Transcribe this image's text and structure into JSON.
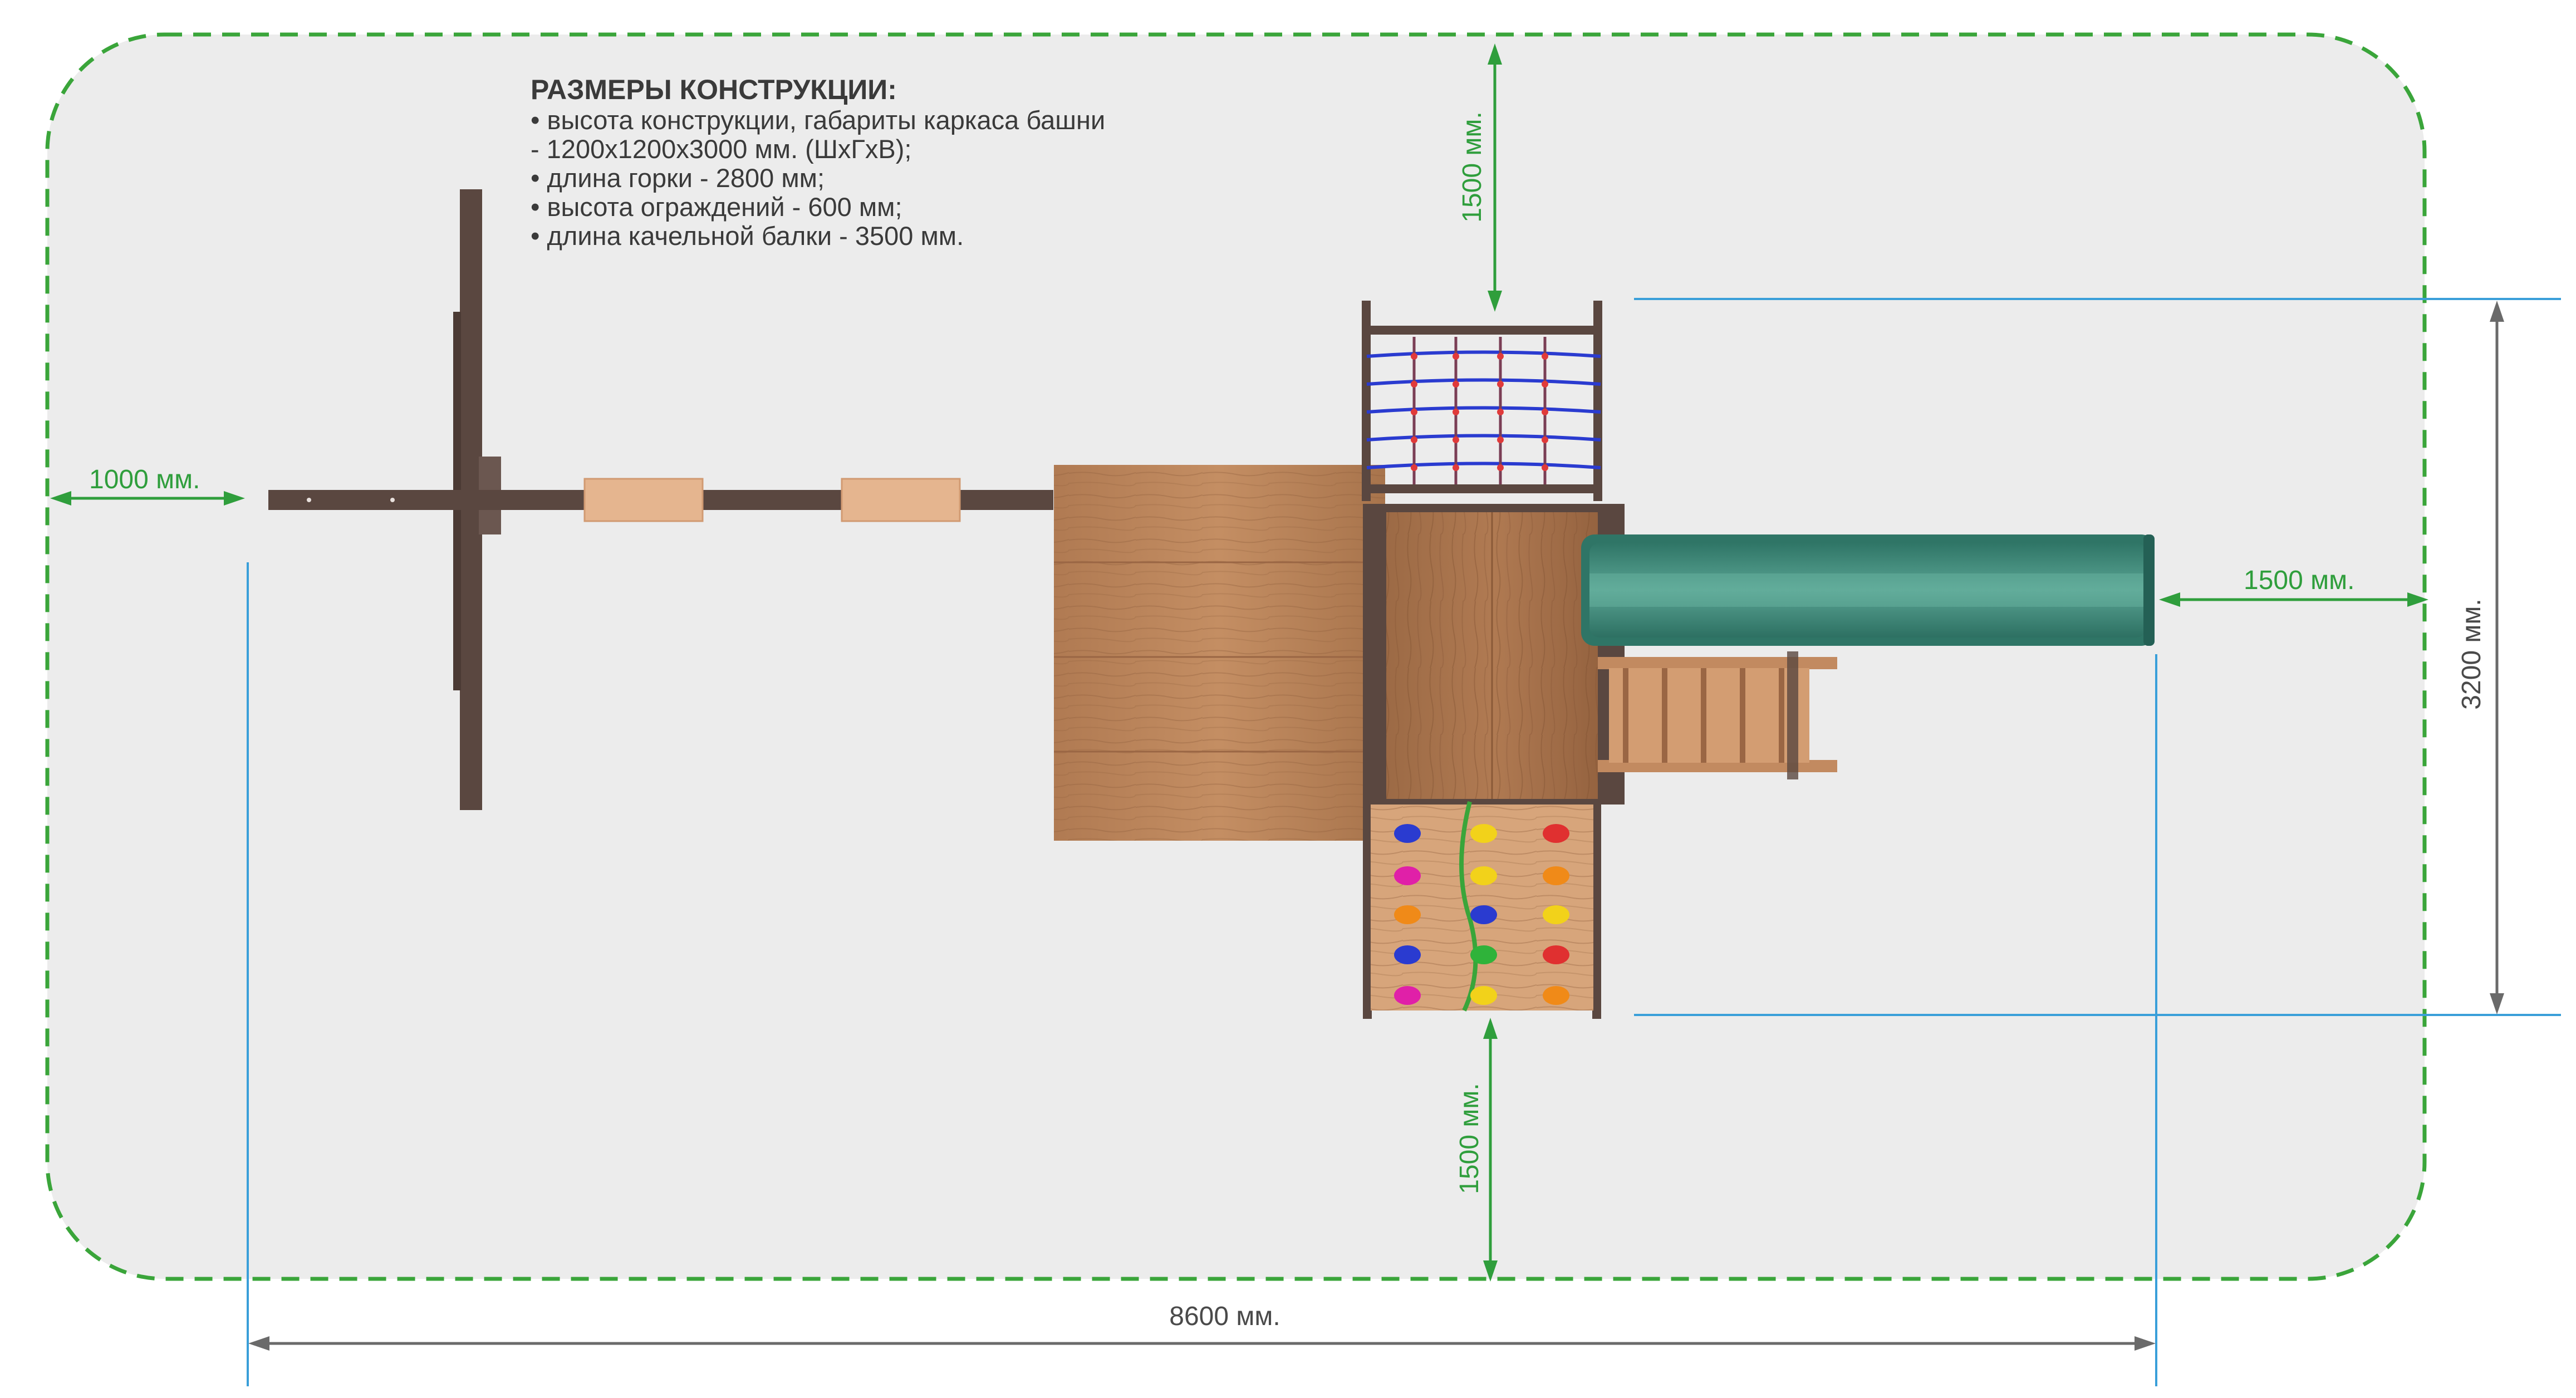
{
  "specs": {
    "title": "РАЗМЕРЫ КОНСТРУКЦИИ:",
    "lines": [
      "•     высота конструкции, габариты каркаса башни",
      "- 1200х1200х3000 мм. (ШхГхВ);",
      "•     длина горки - 2800 мм;",
      "•     высота ограждений - 600 мм;",
      "•     длина качельной балки - 3500 мм."
    ]
  },
  "dimensions": {
    "left_clearance": "1000 мм.",
    "top_clearance": "1500 мм.",
    "bottom_clearance": "1500 мм.",
    "right_clearance": "1500 мм.",
    "depth": "3200 мм.",
    "total_length": "8600 мм."
  },
  "colors": {
    "zone_fill": "#ececec",
    "zone_border": "#3aa53a",
    "dim_green": "#2f9e3c",
    "dim_gray": "#6a6a6a",
    "guide_blue": "#3a9fd9",
    "beam_brown": "#5a4740",
    "wood_light": "#b9835a",
    "wood_dark": "#a1704b",
    "slide_green": "#3f8a7a"
  },
  "climbing_holds": [
    [
      "#2a3bd0",
      "#f2d21a",
      "#e03030"
    ],
    [
      "#e020a8",
      "#f2d21a",
      "#f08a18"
    ],
    [
      "#f08a18",
      "#2a3bd0",
      "#f2d21a"
    ],
    [
      "#2a3bd0",
      "#2fb33a",
      "#e03030"
    ],
    [
      "#e020a8",
      "#f2d21a",
      "#f08a18"
    ]
  ]
}
